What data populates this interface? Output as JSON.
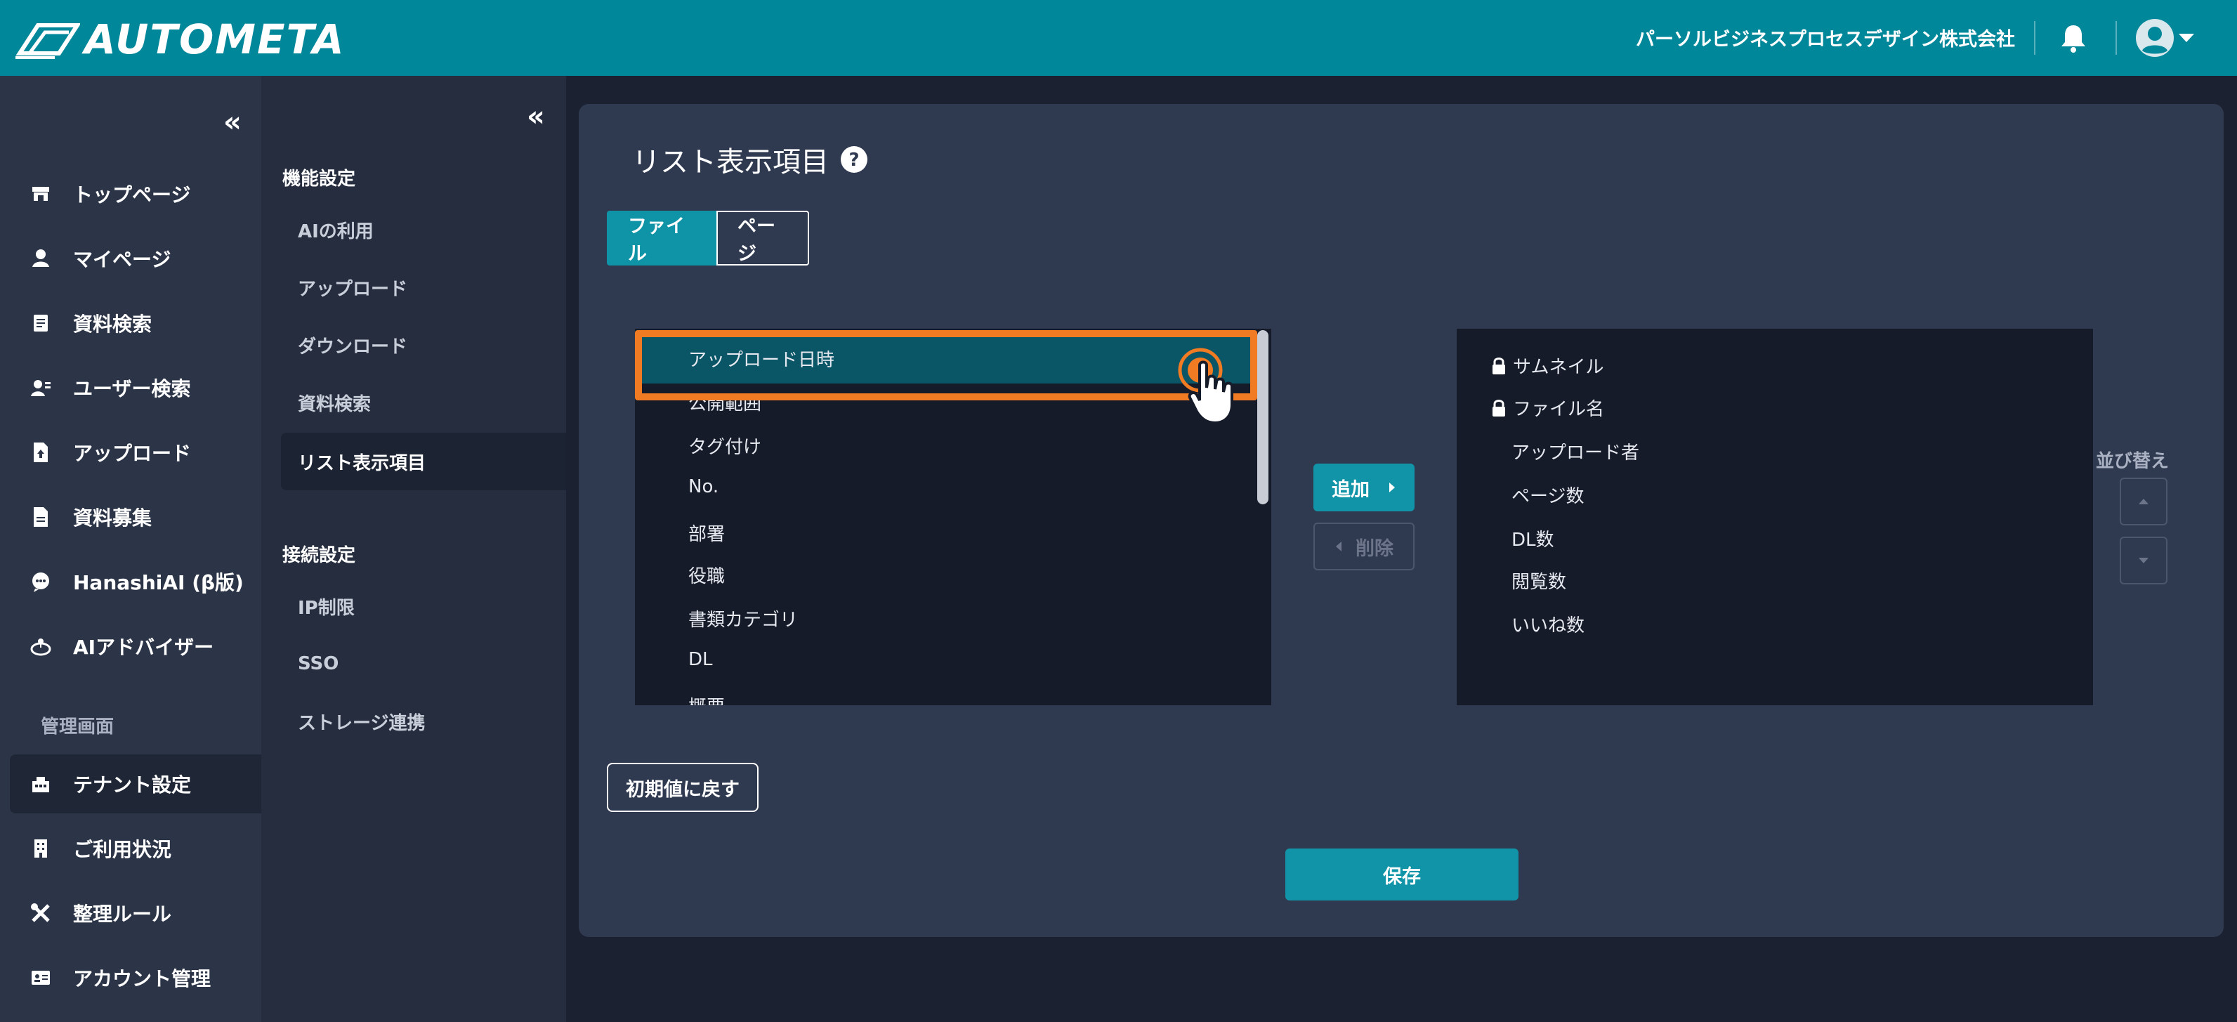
{
  "header": {
    "logo_text": "AUTOMETA",
    "company": "パーソルビジネスプロセスデザイン株式会社",
    "bg_color": "#00879a"
  },
  "sidebar": {
    "collapse_icon": "«",
    "items": [
      {
        "label": "トップページ",
        "icon": "store-icon"
      },
      {
        "label": "マイページ",
        "icon": "person-icon"
      },
      {
        "label": "資料検索",
        "icon": "document-search-icon"
      },
      {
        "label": "ユーザー検索",
        "icon": "user-search-icon"
      },
      {
        "label": "アップロード",
        "icon": "file-upload-icon"
      },
      {
        "label": "資料募集",
        "icon": "file-icon"
      },
      {
        "label": "HanashiAI (β版)",
        "icon": "chat-ai-icon"
      },
      {
        "label": "AIアドバイザー",
        "icon": "robot-icon"
      }
    ],
    "admin_section": "管理画面",
    "admin_items": [
      {
        "label": "テナント設定",
        "icon": "tenant-icon",
        "active": true
      },
      {
        "label": "ご利用状況",
        "icon": "building-icon"
      },
      {
        "label": "整理ルール",
        "icon": "tools-icon"
      },
      {
        "label": "アカウント管理",
        "icon": "id-card-icon"
      }
    ]
  },
  "subsidebar": {
    "collapse_icon": "«",
    "section1": "機能設定",
    "section1_items": [
      "AIの利用",
      "アップロード",
      "ダウンロード",
      "資料検索",
      "リスト表示項目"
    ],
    "active_item": "リスト表示項目",
    "section2": "接続設定",
    "section2_items": [
      "IP制限",
      "SSO",
      "ストレージ連携"
    ]
  },
  "main": {
    "title": "リスト表示項目",
    "tabs": [
      {
        "label": "ファイル",
        "active": true
      },
      {
        "label": "ページ",
        "active": false
      }
    ],
    "available_items": [
      "アップロード日時",
      "公開範囲",
      "タグ付け",
      "No.",
      "部署",
      "役職",
      "書類カテゴリ",
      "DL",
      "概要"
    ],
    "selected_available": "アップロード日時",
    "add_button": "追加",
    "delete_button": "削除",
    "displayed_items": [
      {
        "label": "サムネイル",
        "locked": true
      },
      {
        "label": "ファイル名",
        "locked": true
      },
      {
        "label": "アップロード者",
        "locked": false
      },
      {
        "label": "ページ数",
        "locked": false
      },
      {
        "label": "DL数",
        "locked": false
      },
      {
        "label": "閲覧数",
        "locked": false
      },
      {
        "label": "いいね数",
        "locked": false
      }
    ],
    "sort_label": "並び替え",
    "reset_button": "初期値に戻す",
    "save_button": "保存",
    "accent_color": "#1294a8",
    "highlight_color": "#f07b23"
  }
}
